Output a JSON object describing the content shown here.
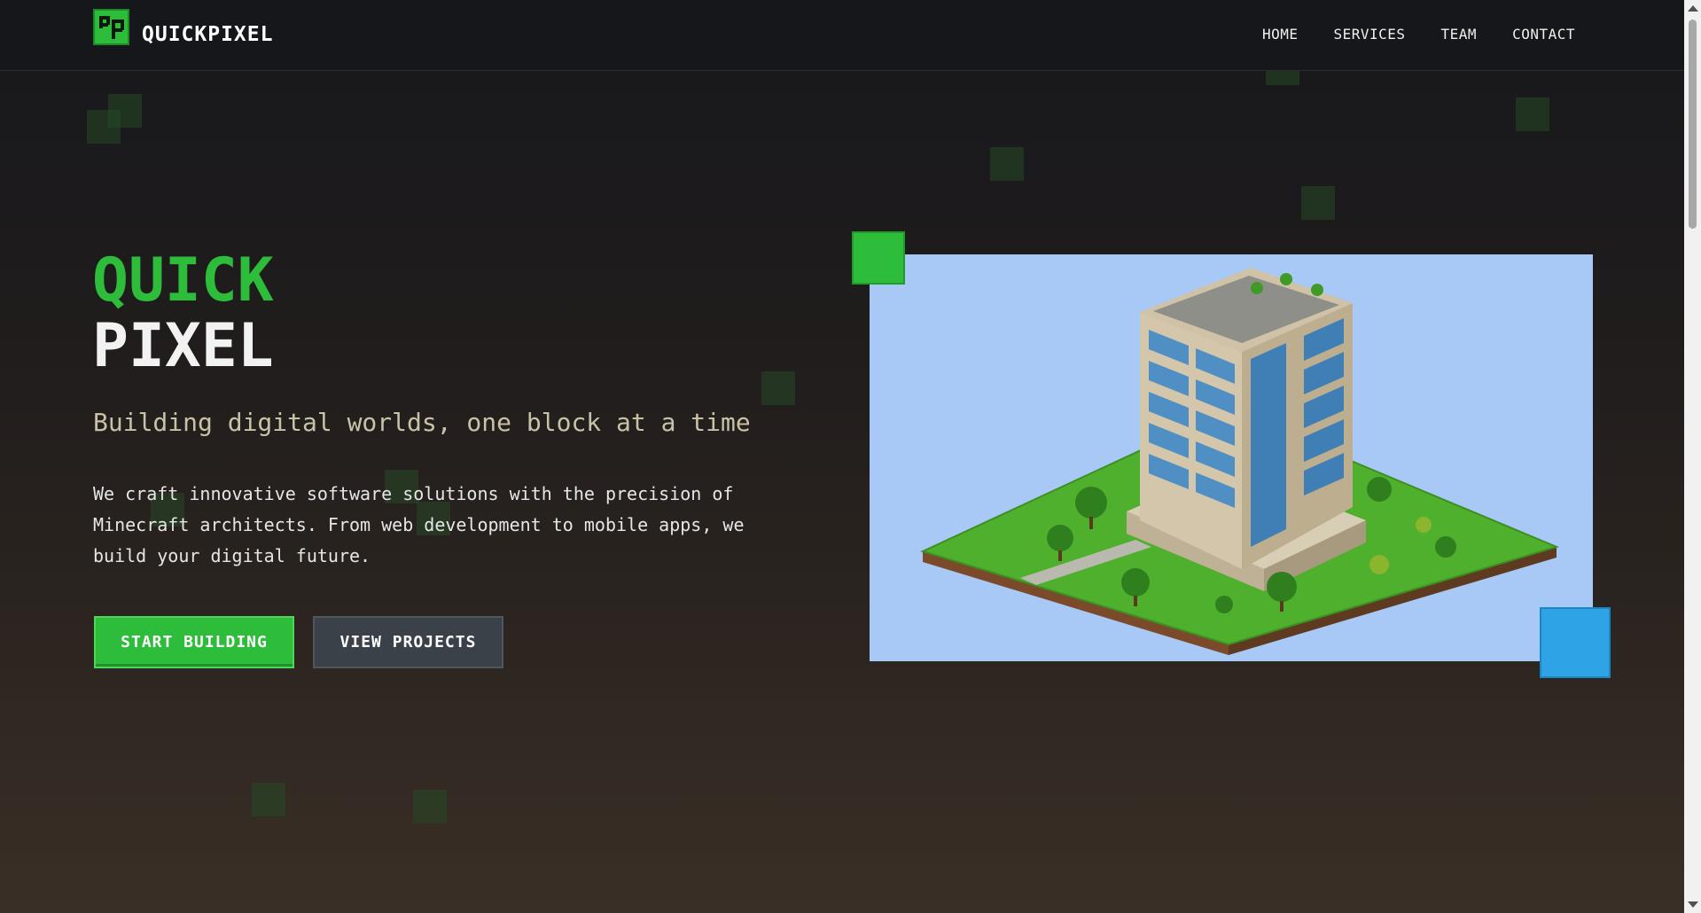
{
  "brand": {
    "name": "QUICKPIXEL",
    "logo_icon": "qp-logo-icon"
  },
  "nav": {
    "items": [
      "HOME",
      "SERVICES",
      "TEAM",
      "CONTACT"
    ]
  },
  "hero": {
    "title_line1": "QUICK",
    "title_line2": "PIXEL",
    "tagline": "Building digital worlds, one block at a time",
    "description": "We craft innovative software solutions with the precision of Minecraft architects. From web development to mobile apps, we build your digital future.",
    "primary_button": "START BUILDING",
    "secondary_button": "VIEW PROJECTS",
    "image_subject": "isometric-voxel-office-building"
  },
  "colors": {
    "accent_green": "#2ebd3a",
    "accent_blue": "#2ea3e6",
    "secondary_button": "#3a4148",
    "tagline": "#c9c2a8"
  }
}
